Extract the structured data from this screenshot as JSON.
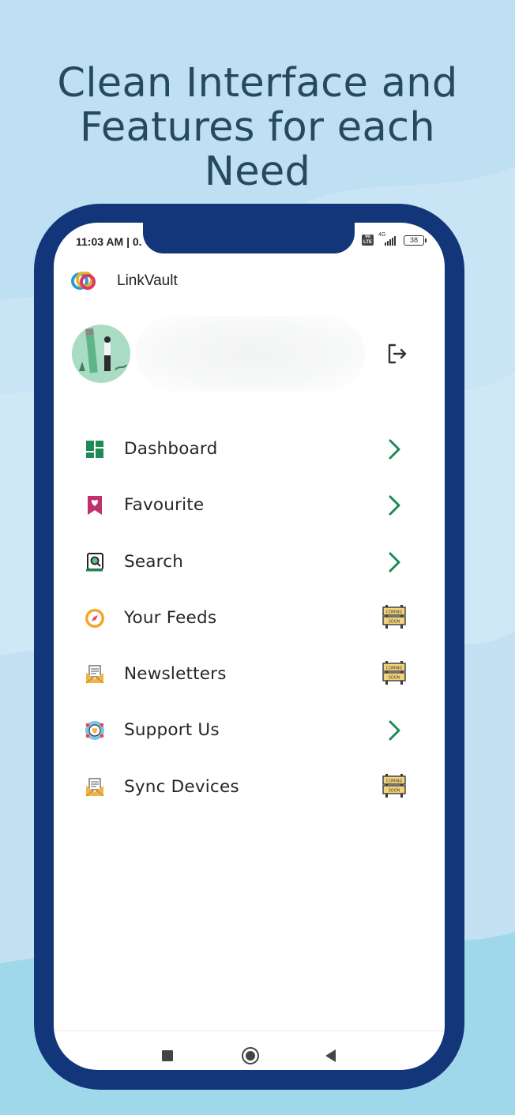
{
  "headline": {
    "line1": "Clean Interface and",
    "line2": "Features for each",
    "line3": "Need"
  },
  "status_bar": {
    "time": "11:03 AM | 0.",
    "network": "4G",
    "volte": "Vo LTE",
    "battery": "38"
  },
  "app": {
    "title": "LinkVault"
  },
  "menu": {
    "items": [
      {
        "label": "Dashboard",
        "icon": "dashboard-icon",
        "action": "chevron"
      },
      {
        "label": "Favourite",
        "icon": "bookmark-heart-icon",
        "action": "chevron"
      },
      {
        "label": "Search",
        "icon": "search-icon",
        "action": "chevron"
      },
      {
        "label": "Your Feeds",
        "icon": "compass-icon",
        "action": "coming-soon"
      },
      {
        "label": "Newsletters",
        "icon": "newsletter-envelope-icon",
        "action": "coming-soon"
      },
      {
        "label": "Support Us",
        "icon": "support-icon",
        "action": "chevron"
      },
      {
        "label": "Sync Devices",
        "icon": "sync-envelope-icon",
        "action": "coming-soon"
      }
    ]
  },
  "coming_soon_sign": {
    "line1": "COMING",
    "line2": "SOON"
  },
  "colors": {
    "background": "#bfdff2",
    "phone_frame": "#13367a",
    "headline": "#264a5c",
    "accent_green": "#1f8a58",
    "favourite_pink": "#c0306e"
  }
}
